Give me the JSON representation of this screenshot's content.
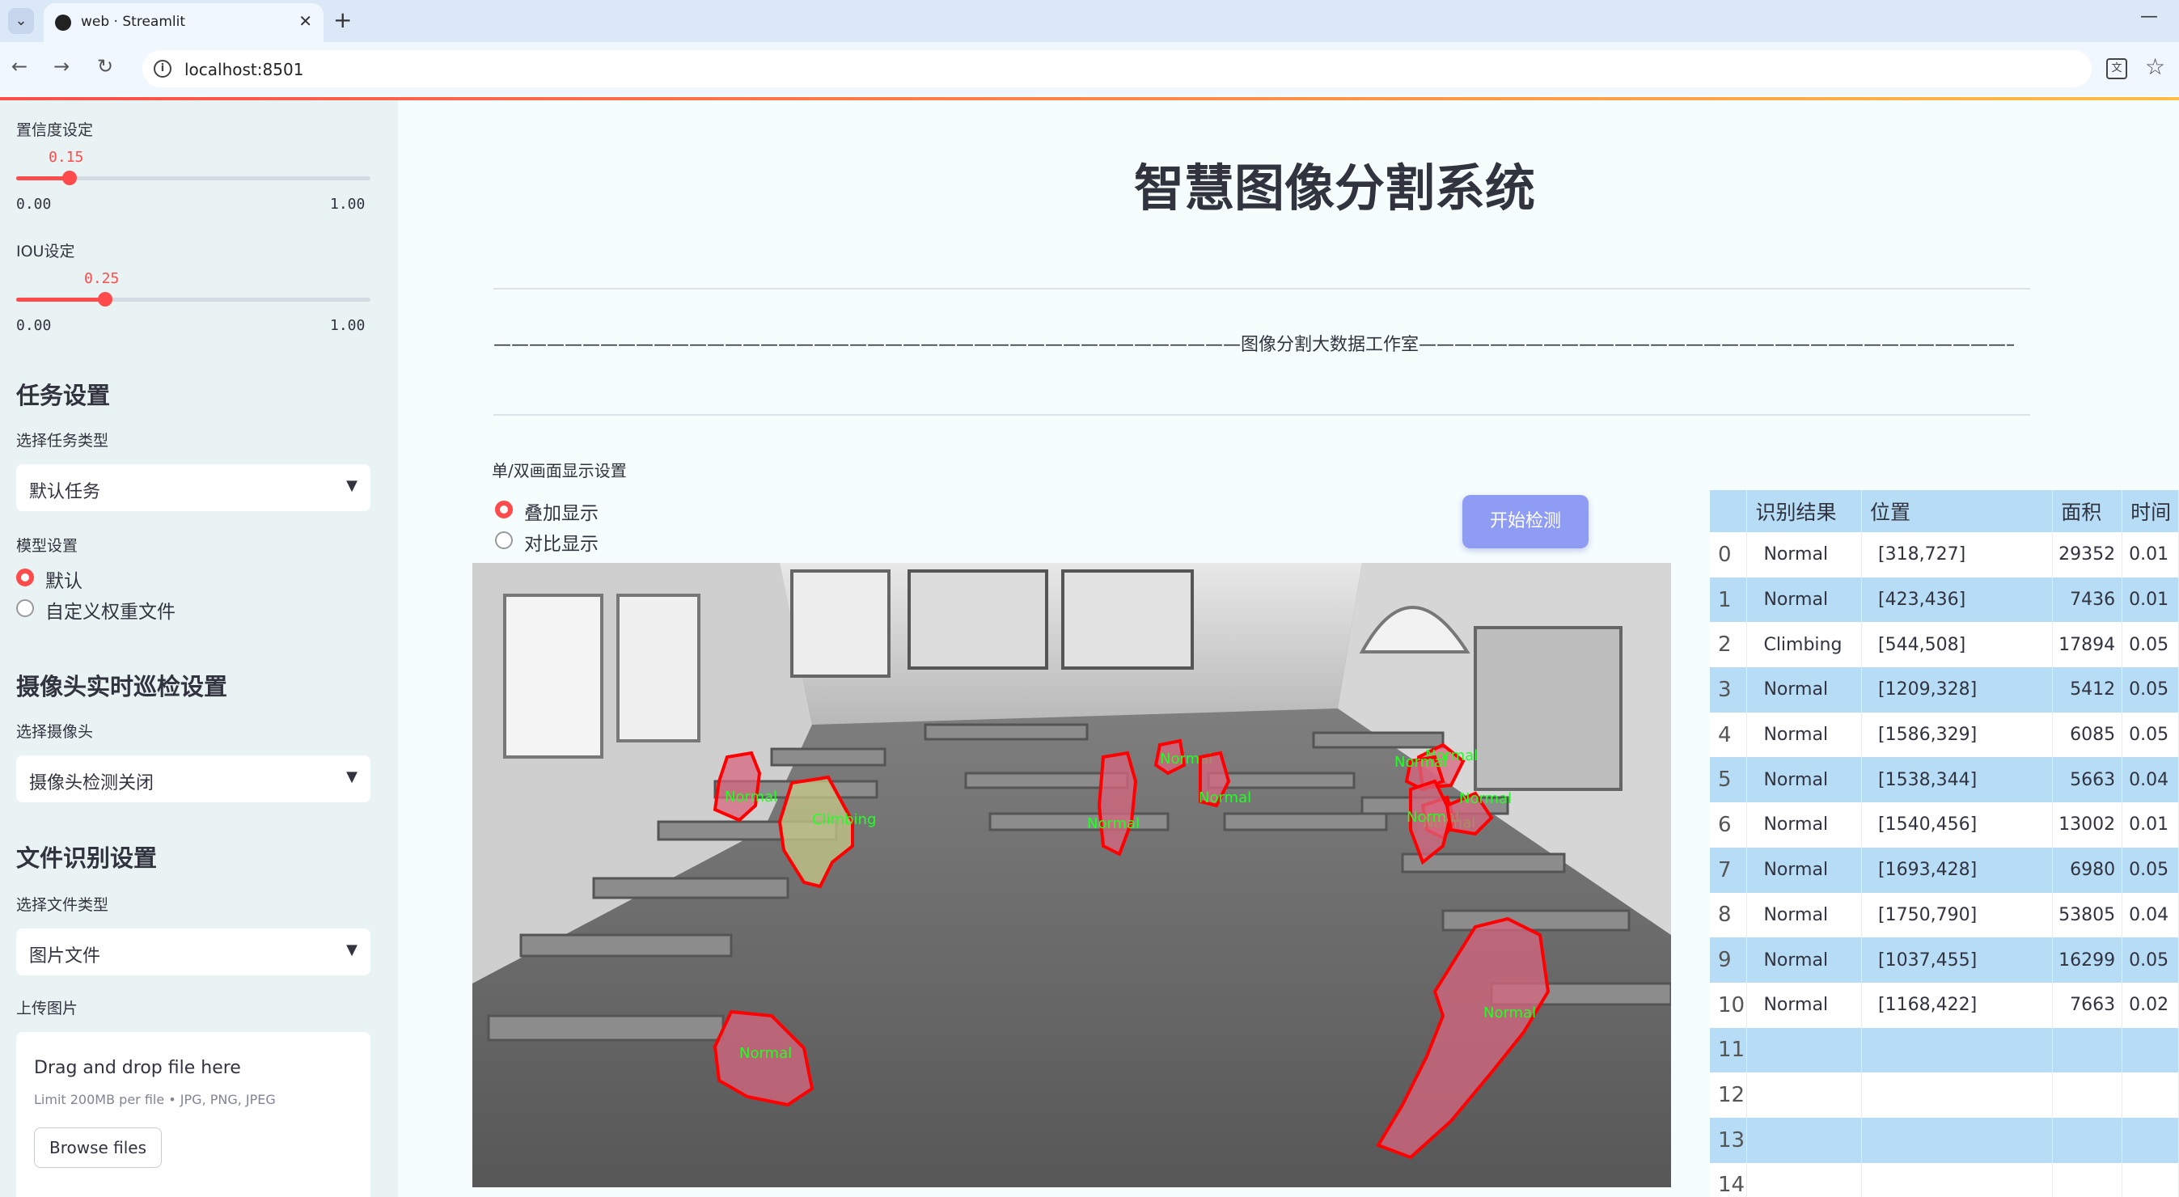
{
  "browser": {
    "tab_title": "web · Streamlit",
    "url": "localhost:8501"
  },
  "sidebar": {
    "confidence": {
      "label": "置信度设定",
      "value": "0.15",
      "value_num": 0.15,
      "min": "0.00",
      "max": "1.00"
    },
    "iou": {
      "label": "IOU设定",
      "value": "0.25",
      "value_num": 0.25,
      "min": "0.00",
      "max": "1.00"
    },
    "task_header": "任务设置",
    "task_type_label": "选择任务类型",
    "task_type_value": "默认任务",
    "model_label": "模型设置",
    "model_options": [
      "默认",
      "自定义权重文件"
    ],
    "model_selected": "默认",
    "camera_header": "摄像头实时巡检设置",
    "camera_label": "选择摄像头",
    "camera_value": "摄像头检测关闭",
    "file_header": "文件识别设置",
    "file_type_label": "选择文件类型",
    "file_type_value": "图片文件",
    "upload_label": "上传图片",
    "uploader": {
      "title": "Drag and drop file here",
      "limit": "Limit 200MB per file • JPG, PNG, JPEG",
      "button": "Browse files"
    }
  },
  "main": {
    "title": "智慧图像分割系统",
    "divider_text": "——————————————————————————————————————————图像分割大数据工作室——————————————————————————————————————————",
    "display_label": "单/双画面显示设置",
    "display_options": [
      "叠加显示",
      "对比显示"
    ],
    "display_selected": "叠加显示",
    "start_button": "开始检测"
  },
  "detections": {
    "labels": [
      "Normal",
      "Normal",
      "Climbing",
      "Normal",
      "Normal",
      "Normal",
      "Normal",
      "Normal",
      "Normal",
      "Normal",
      "Normal",
      "Normal",
      "Normal"
    ],
    "mask_color_normal": "#d8667f",
    "mask_color_climbing": "#c8c98a",
    "outline_color": "#ff0000",
    "label_color": "#22ff22"
  },
  "table": {
    "headers": [
      "",
      "识别结果",
      "位置",
      "面积",
      "时间"
    ],
    "rows": [
      {
        "index": "0",
        "result": "Normal",
        "position": "[318,727]",
        "area": "29352",
        "time": "0.01"
      },
      {
        "index": "1",
        "result": "Normal",
        "position": "[423,436]",
        "area": "7436",
        "time": "0.01"
      },
      {
        "index": "2",
        "result": "Climbing",
        "position": "[544,508]",
        "area": "17894",
        "time": "0.05"
      },
      {
        "index": "3",
        "result": "Normal",
        "position": "[1209,328]",
        "area": "5412",
        "time": "0.05"
      },
      {
        "index": "4",
        "result": "Normal",
        "position": "[1586,329]",
        "area": "6085",
        "time": "0.05"
      },
      {
        "index": "5",
        "result": "Normal",
        "position": "[1538,344]",
        "area": "5663",
        "time": "0.04"
      },
      {
        "index": "6",
        "result": "Normal",
        "position": "[1540,456]",
        "area": "13002",
        "time": "0.01"
      },
      {
        "index": "7",
        "result": "Normal",
        "position": "[1693,428]",
        "area": "6980",
        "time": "0.05"
      },
      {
        "index": "8",
        "result": "Normal",
        "position": "[1750,790]",
        "area": "53805",
        "time": "0.04"
      },
      {
        "index": "9",
        "result": "Normal",
        "position": "[1037,455]",
        "area": "16299",
        "time": "0.05"
      },
      {
        "index": "10",
        "result": "Normal",
        "position": "[1168,422]",
        "area": "7663",
        "time": "0.02"
      },
      {
        "index": "11",
        "result": "",
        "position": "",
        "area": "",
        "time": ""
      },
      {
        "index": "12",
        "result": "",
        "position": "",
        "area": "",
        "time": ""
      },
      {
        "index": "13",
        "result": "",
        "position": "",
        "area": "",
        "time": ""
      },
      {
        "index": "14",
        "result": "",
        "position": "",
        "area": "",
        "time": ""
      }
    ]
  }
}
